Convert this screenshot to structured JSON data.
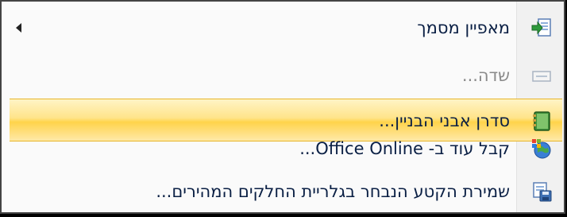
{
  "menu": {
    "items": [
      {
        "label": "מאפיין מסמך",
        "icon": "document-property-icon",
        "submenu": true,
        "disabled": false
      },
      {
        "label": "שדה...",
        "icon": "field-icon",
        "submenu": false,
        "disabled": true
      },
      {
        "label": "סדרן אבני הבניין...",
        "icon": "building-blocks-organizer-icon",
        "submenu": false,
        "disabled": false,
        "highlighted": true
      },
      {
        "label": "קבל עוד ב- Office Online...",
        "icon": "office-online-icon",
        "submenu": false,
        "disabled": false
      },
      {
        "label": "שמירת הקטע הנבחר בגלריית החלקים המהירים...",
        "icon": "save-selection-icon",
        "submenu": false,
        "disabled": false
      }
    ]
  },
  "colors": {
    "highlight": "#ffd34a",
    "text": "#0a1f44",
    "disabled_text": "#8a8a8a"
  }
}
